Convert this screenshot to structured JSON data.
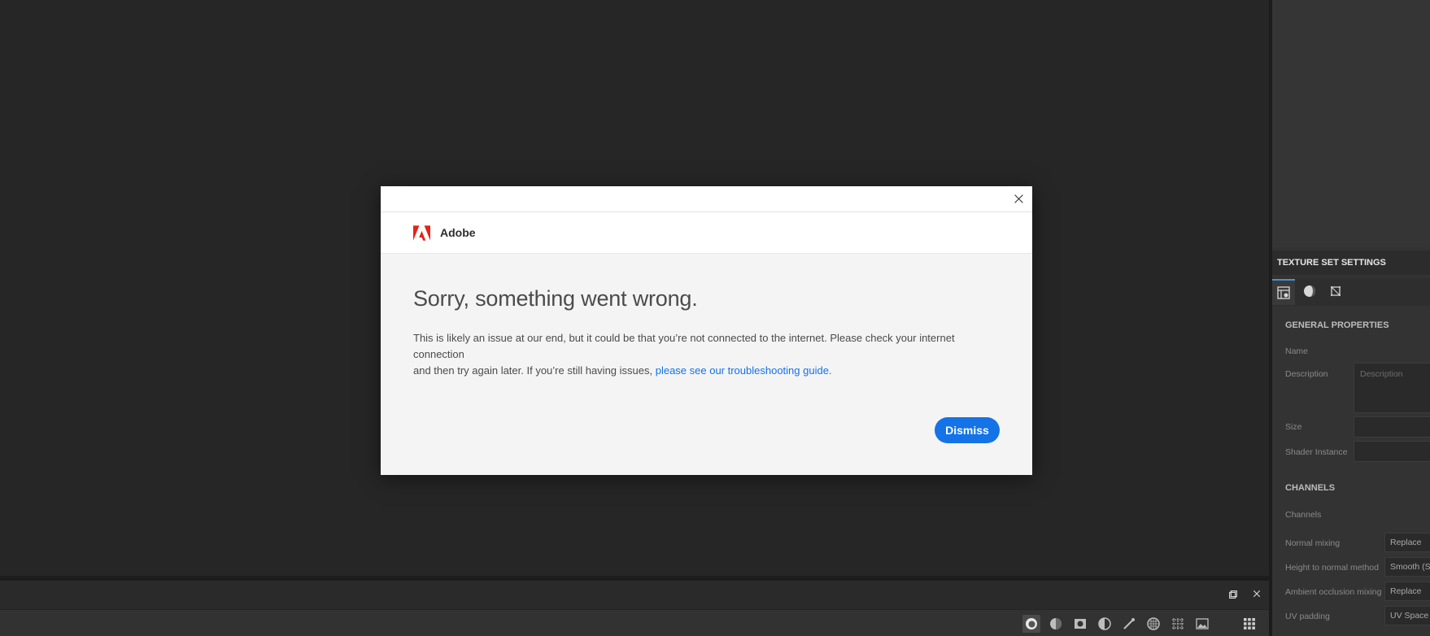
{
  "dialog": {
    "brand": "Adobe",
    "heading": "Sorry, something went wrong.",
    "message_line1": "This is likely an issue at our end, but it could be that you’re not connected to the internet. Please check your internet connection",
    "message_line2_prefix": "and then try again later. If you’re still having issues, ",
    "link_text": "please see our troubleshooting guide.",
    "dismiss_label": "Dismiss",
    "close_icon": "close-icon",
    "logo_icon": "adobe-logo-icon",
    "accent_color": "#1473e6",
    "logo_color": "#e1251b"
  },
  "bottom_bar": {
    "icons": [
      "restore-window-icon",
      "close-icon"
    ]
  },
  "bottom_tools": {
    "icons": [
      "material-sphere-icon",
      "half-sphere-icon",
      "square-mask-icon",
      "contrast-icon",
      "brush-icon",
      "checker-sphere-icon",
      "grid-icon",
      "image-icon",
      "apps-grid-icon"
    ]
  },
  "right_panel": {
    "header": "TEXTURE SET SETTINGS",
    "tabs": [
      "texture-settings-icon",
      "sphere-icon",
      "uv-frame-icon"
    ],
    "general": {
      "title": "GENERAL PROPERTIES",
      "name_label": "Name",
      "description_label": "Description",
      "description_placeholder": "Description",
      "size_label": "Size",
      "shader_label": "Shader Instance"
    },
    "channels": {
      "title": "CHANNELS",
      "channels_label": "Channels",
      "rows": [
        {
          "label": "Normal mixing",
          "value": "Replace"
        },
        {
          "label": "Height to normal method",
          "value": "Smooth (S"
        },
        {
          "label": "Ambient occlusion mixing",
          "value": "Replace"
        },
        {
          "label": "UV padding",
          "value": "UV Space N"
        }
      ]
    }
  }
}
